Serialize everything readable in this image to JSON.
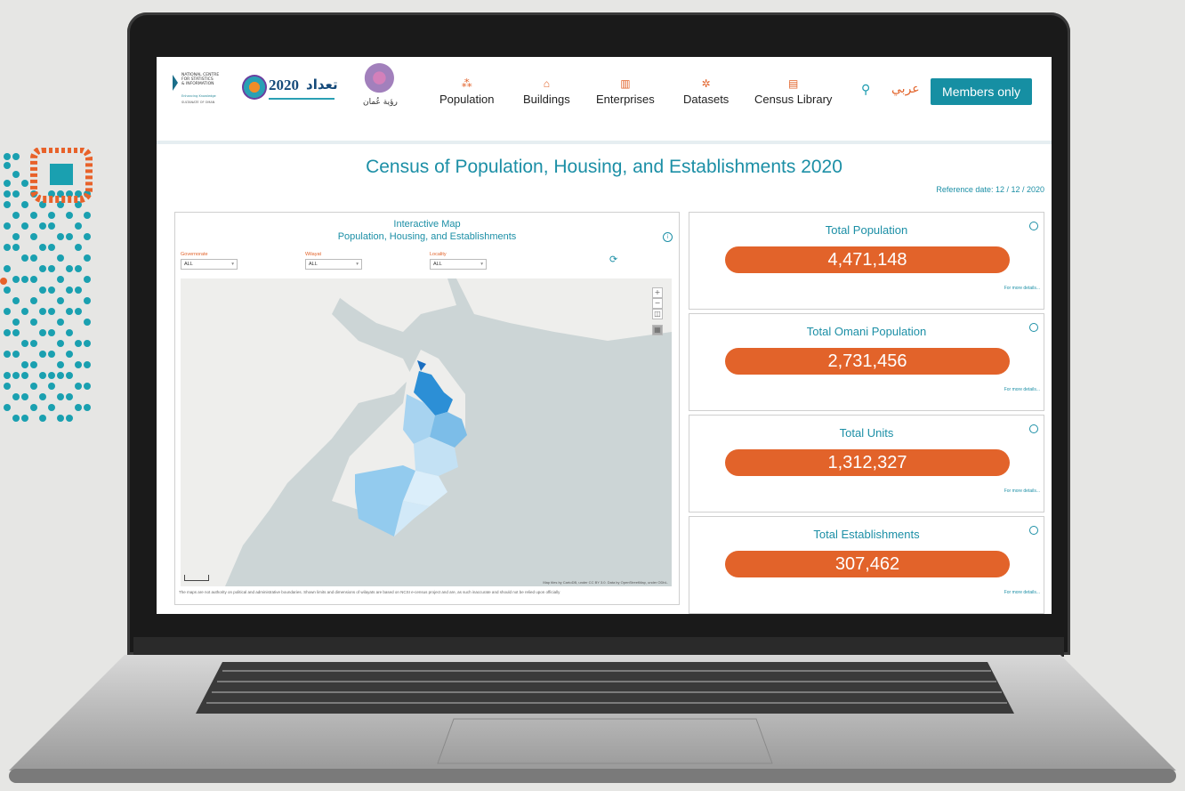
{
  "header": {
    "ncsi_logo": {
      "lines": [
        "NATIONAL CENTRE",
        "FOR STATISTICS",
        "& INFORMATION"
      ],
      "sub": "Enhancing Knowledge",
      "sub2": "SULTANATE OF OMAN"
    },
    "census_logo": {
      "year": "2020",
      "arabic": "تعداد"
    },
    "vision_logo": {
      "text": "رؤية عُمان"
    },
    "nav": [
      {
        "label": "Population",
        "icon": "population-icon"
      },
      {
        "label": "Buildings",
        "icon": "buildings-icon"
      },
      {
        "label": "Enterprises",
        "icon": "enterprises-icon"
      },
      {
        "label": "Datasets",
        "icon": "datasets-icon"
      },
      {
        "label": "Census Library",
        "icon": "library-icon"
      }
    ],
    "language": "عربي",
    "members_button": "Members only"
  },
  "page_title": "Census of Population, Housing, and Establishments 2020",
  "reference_date": "Reference date: 12 / 12 / 2020",
  "map_panel": {
    "title_line1": "Interactive Map",
    "title_line2": "Population, Housing, and Establishments",
    "filters": [
      {
        "label": "Governorate",
        "value": "ALL"
      },
      {
        "label": "Wilayat",
        "value": "ALL"
      },
      {
        "label": "Locality",
        "value": "ALL"
      }
    ],
    "attribution": "Map tiles by CartoDB, under CC BY 3.0. Data by OpenStreetMap, under ODbL.",
    "disclaimer": "The maps are not authority on political and administrative boundaries. Shown limits and dimensions of wilayats are based on NCSI e-census project and are, as such inaccurate and should not be relied upon officially"
  },
  "stats": [
    {
      "title": "Total Population",
      "value": "4,471,148",
      "more": "For more details..."
    },
    {
      "title": "Total Omani Population",
      "value": "2,731,456",
      "more": "For more details..."
    },
    {
      "title": "Total Units",
      "value": "1,312,327",
      "more": "For more details..."
    },
    {
      "title": "Total Establishments",
      "value": "307,462",
      "more": "For more details..."
    }
  ],
  "colors": {
    "accent": "#1c8fa6",
    "orange": "#e2632a",
    "button": "#168fa3"
  }
}
